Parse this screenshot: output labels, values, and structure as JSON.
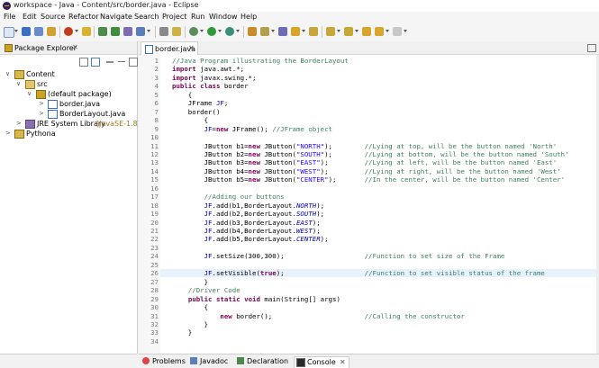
{
  "window": {
    "title": "workspace - Java - Content/src/border.java - Eclipse"
  },
  "menu": [
    "File",
    "Edit",
    "Source",
    "Refactor",
    "Navigate",
    "Search",
    "Project",
    "Run",
    "Window",
    "Help"
  ],
  "package_explorer": {
    "tab_label": "Package Explorer",
    "close": "✕",
    "tree": [
      {
        "label": "Content",
        "twisty": "∨",
        "icon": "project-icon"
      },
      {
        "label": "src",
        "twisty": "∨",
        "icon": "source-folder-icon"
      },
      {
        "label": "(default package)",
        "twisty": "∨",
        "icon": "package-icon"
      },
      {
        "label": "border.java",
        "twisty": ">",
        "icon": "java-file-icon"
      },
      {
        "label": "BorderLayout.java",
        "twisty": ">",
        "icon": "java-file-icon"
      },
      {
        "label": "JRE System Library",
        "suffix": "[JavaSE-1.8]",
        "twisty": ">",
        "icon": "library-icon"
      },
      {
        "label": "Pythona",
        "twisty": ">",
        "icon": "project-icon"
      }
    ]
  },
  "editor": {
    "tab_label": "border.java",
    "close": "✕",
    "line_numbers": [
      "1",
      "2",
      "3",
      "4",
      "5",
      "6",
      "7",
      "8",
      "9",
      "10",
      "11",
      "12",
      "13",
      "14",
      "15",
      "16",
      "17",
      "18",
      "19",
      "20",
      "21",
      "22",
      "23",
      "24",
      "25",
      "26",
      "27",
      "28",
      "29",
      "30",
      "31",
      "32",
      "33",
      "34"
    ],
    "lines": [
      "//Java Program illustrating the BorderLayout",
      "import java.awt.*;",
      "import javax.swing.*;",
      "public class border",
      "    {",
      "    JFrame JF;",
      "    border()",
      "        {",
      "        JF=new JFrame(); //JFrame object",
      "",
      "        JButton b1=new JButton(\"NORTH\");        //Lying at top, will be the button named 'North'",
      "        JButton b2=new JButton(\"SOUTH\");        //Lying at bottom, will be the button named 'South'",
      "        JButton b3=new JButton(\"EAST\");         //Lying at left, will be the button named 'East'",
      "        JButton b4=new JButton(\"WEST\");         //Lying at right, will be the button named 'West'",
      "        JButton b5=new JButton(\"CENTER\");       //In the center, will be the button named 'Center'",
      "",
      "        //Adding our buttons",
      "        JF.add(b1,BorderLayout.NORTH);",
      "        JF.add(b2,BorderLayout.SOUTH);",
      "        JF.add(b3,BorderLayout.EAST);",
      "        JF.add(b4,BorderLayout.WEST);",
      "        JF.add(b5,BorderLayout.CENTER);",
      "",
      "        JF.setSize(300,300);                    //Function to set size of the Frame",
      "",
      "        JF.setVisible(true);                    //Function to set visible status of the frame",
      "        }",
      "    //Driver Code",
      "    public static void main(String[] args)",
      "        {",
      "            new border();                       //Calling the constructor",
      "        }",
      "    }",
      ""
    ],
    "highlighted_line": 26
  },
  "bottom_tabs": [
    {
      "label": "Problems",
      "icon": "problems-icon",
      "active": false
    },
    {
      "label": "Javadoc",
      "icon": "javadoc-icon",
      "active": false
    },
    {
      "label": "Declaration",
      "icon": "declaration-icon",
      "active": false
    },
    {
      "label": "Console",
      "icon": "console-icon",
      "active": true,
      "close": "✕"
    }
  ],
  "colors": {
    "keyword": "#7f0055",
    "comment": "#3f7f5f",
    "string": "#2a00ff",
    "field": "#0000c0",
    "highlight": "#e8f2fe"
  }
}
